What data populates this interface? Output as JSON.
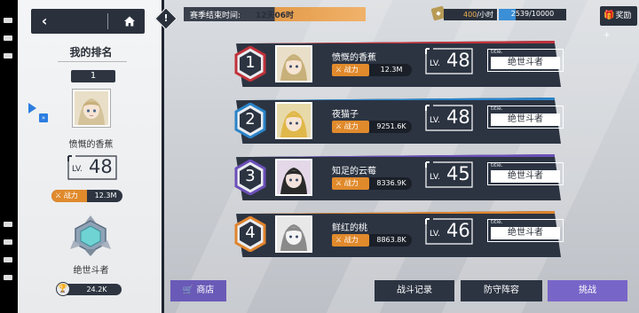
{
  "colors": {
    "panel_dark": "#2c3442",
    "orange": "#e08a2c",
    "blue_accent": "#3b8fd6",
    "purple_button": "#7865c8",
    "rank1": "#c0323a",
    "rank2": "#2a84c8",
    "rank3": "#6b4fb8",
    "rank4": "#e0842c"
  },
  "nav": {
    "back_icon": "chevron-left-icon",
    "home_icon": "home-icon"
  },
  "my_rank": {
    "title": "我的排名",
    "rank": "1",
    "name": "愤慨的香蕉",
    "level_prefix": "LV.",
    "level": "48",
    "power_label": "战力",
    "power_value": "12.3M",
    "title_name": "绝世斗者",
    "trophies": "24.2K"
  },
  "hud": {
    "season_label": "赛季结束时间:",
    "season_value": "12天06时",
    "stamina_value": "400",
    "stamina_unit": "/小时",
    "exp_text": "2539/10000",
    "exp_fraction": 0.2539,
    "reward_label": "奖励+"
  },
  "ranks": [
    {
      "rank": "1",
      "name": "愤慨的香蕉",
      "power_label": "战力",
      "power_value": "12.3M",
      "level_prefix": "LV.",
      "level": "48",
      "title_small": "title.",
      "title": "绝世斗者"
    },
    {
      "rank": "2",
      "name": "夜猫子",
      "power_label": "战力",
      "power_value": "9251.6K",
      "level_prefix": "LV.",
      "level": "48",
      "title_small": "title.",
      "title": "绝世斗者"
    },
    {
      "rank": "3",
      "name": "知足的云莓",
      "power_label": "战力",
      "power_value": "8336.9K",
      "level_prefix": "LV.",
      "level": "45",
      "title_small": "title.",
      "title": "绝世斗者"
    },
    {
      "rank": "4",
      "name": "鲜红的桃",
      "power_label": "战力",
      "power_value": "8863.8K",
      "level_prefix": "LV.",
      "level": "46",
      "title_small": "title.",
      "title": "绝世斗者"
    }
  ],
  "bottom": {
    "shop": "商店",
    "battle_record": "战斗记录",
    "defense": "防守阵容",
    "challenge": "挑战"
  }
}
